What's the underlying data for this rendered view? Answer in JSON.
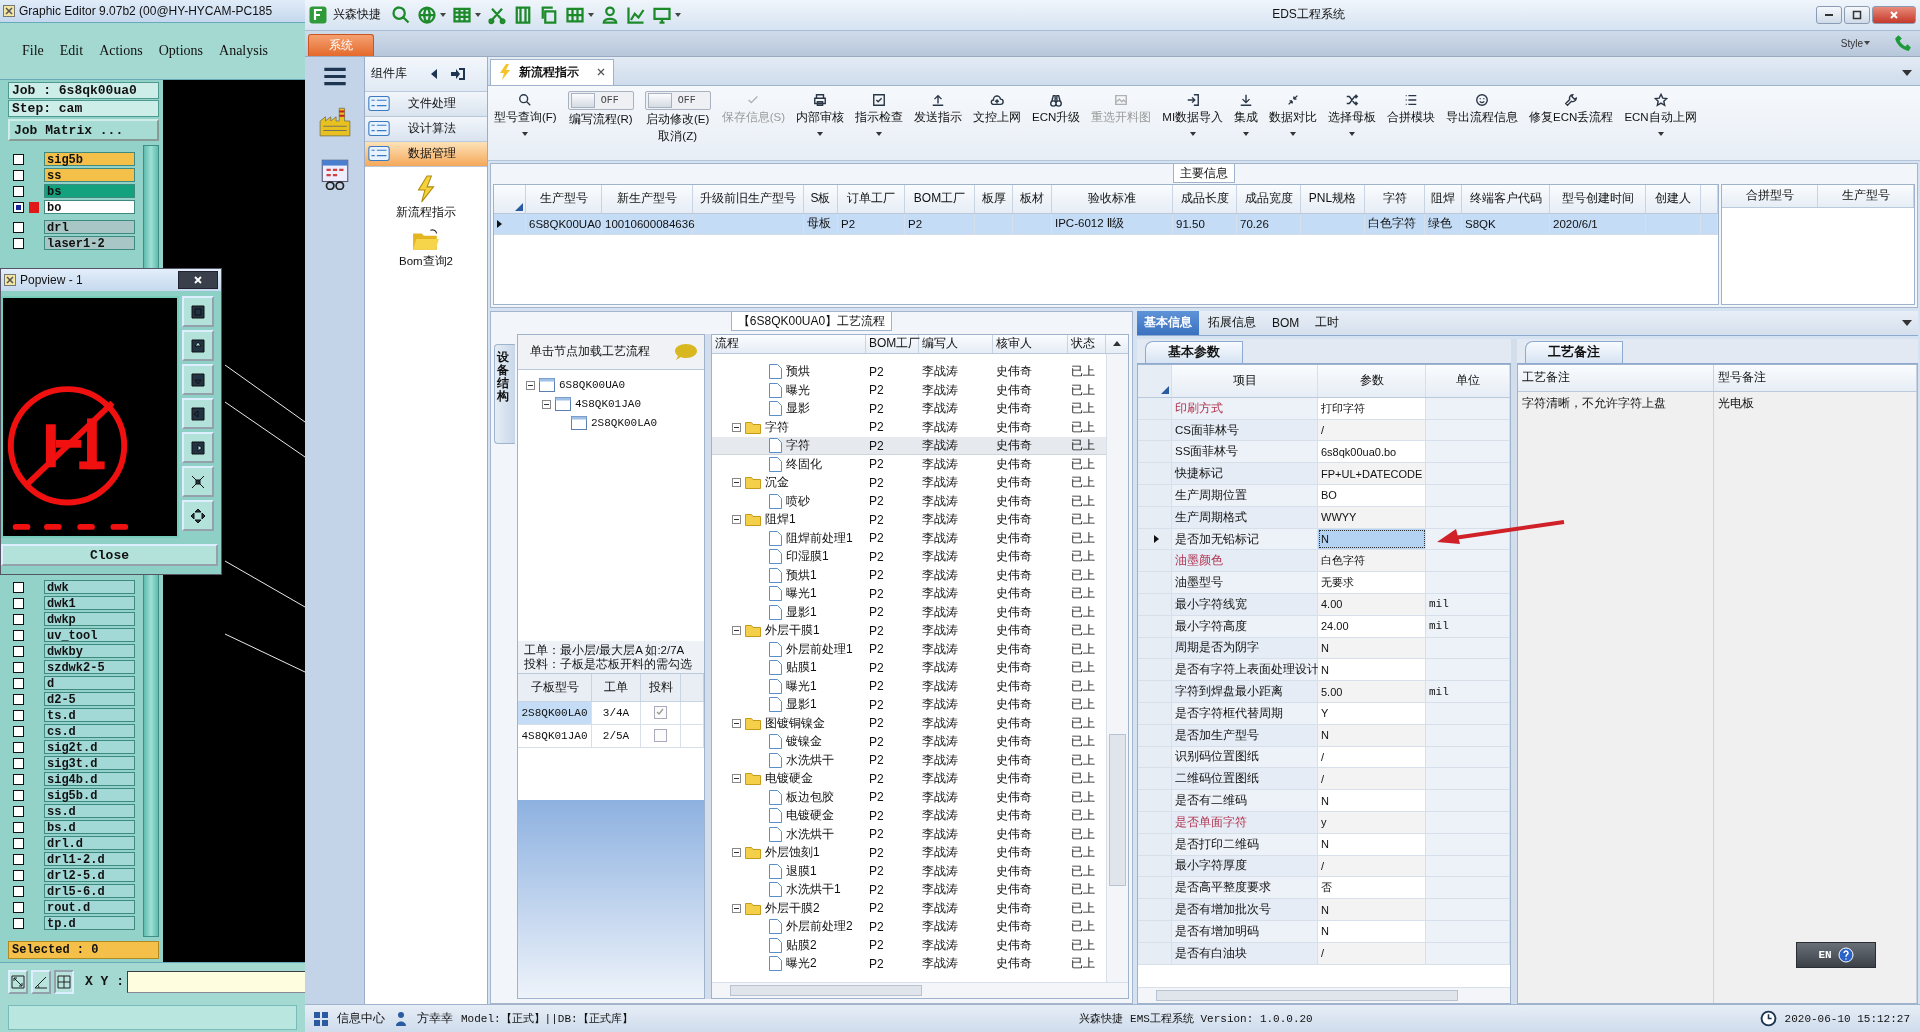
{
  "cad": {
    "title": "Graphic Editor 9.07b2 (00@HY-HYCAM-PC185",
    "menu": [
      "File",
      "Edit",
      "Actions",
      "Options",
      "Analysis"
    ],
    "job": "Job : 6s8qk00ua0",
    "step": "Step: cam",
    "matrix_button": "Job Matrix ...",
    "layers_top": [
      {
        "name": "sig5b",
        "color": "#f5c04a",
        "selected": false
      },
      {
        "name": "ss",
        "color": "#f5c04a",
        "selected": false
      },
      {
        "name": "bs",
        "color": "#14a27e",
        "selected": false
      },
      {
        "name": "bo",
        "color": "#ffffff",
        "selected": true
      },
      {
        "name": "drl",
        "color": "#a8c6c6",
        "selected": false
      },
      {
        "name": "laser1-2",
        "color": "#a8c6c6",
        "selected": false
      }
    ],
    "layers_bottom": [
      {
        "name": "dwk",
        "color": "#a2d8d6",
        "selected": false
      },
      {
        "name": "dwk1",
        "color": "#a2d8d6",
        "selected": false
      },
      {
        "name": "dwkp",
        "color": "#a2d8d6",
        "selected": false
      },
      {
        "name": "uv_tool",
        "color": "#a2d8d6",
        "selected": false
      },
      {
        "name": "dwkby",
        "color": "#a2d8d6",
        "selected": false
      },
      {
        "name": "szdwk2-5",
        "color": "#a2d8d6",
        "selected": false
      },
      {
        "name": "d",
        "color": "#a2d8d6",
        "selected": false
      },
      {
        "name": "d2-5",
        "color": "#a2d8d6",
        "selected": false
      },
      {
        "name": "ts.d",
        "color": "#a2d8d6",
        "selected": false
      },
      {
        "name": "cs.d",
        "color": "#a2d8d6",
        "selected": false
      },
      {
        "name": "sig2t.d",
        "color": "#a2d8d6",
        "selected": false
      },
      {
        "name": "sig3t.d",
        "color": "#a2d8d6",
        "selected": false
      },
      {
        "name": "sig4b.d",
        "color": "#a2d8d6",
        "selected": false
      },
      {
        "name": "sig5b.d",
        "color": "#a2d8d6",
        "selected": false
      },
      {
        "name": "ss.d",
        "color": "#a2d8d6",
        "selected": false
      },
      {
        "name": "bs.d",
        "color": "#a2d8d6",
        "selected": false
      },
      {
        "name": "drl.d",
        "color": "#a2d8d6",
        "selected": false
      },
      {
        "name": "drl1-2.d",
        "color": "#a2d8d6",
        "selected": false
      },
      {
        "name": "drl2-5.d",
        "color": "#a2d8d6",
        "selected": false
      },
      {
        "name": "drl5-6.d",
        "color": "#a2d8d6",
        "selected": false
      },
      {
        "name": "rout.d",
        "color": "#a2d8d6",
        "selected": false
      },
      {
        "name": "tp.d",
        "color": "#a2d8d6",
        "selected": false
      }
    ],
    "selected_count": "Selected : 0",
    "xy_label": "X Y :",
    "popview": {
      "title": "Popview - 1",
      "close": "Close"
    }
  },
  "app": {
    "brand": "兴森快捷",
    "title": "EDS工程系统",
    "system_tab": "系统",
    "style_label": "Style"
  },
  "nav": {
    "header": "组件库",
    "groups": [
      {
        "label": "文件处理",
        "selected": false
      },
      {
        "label": "设计算法",
        "selected": false
      },
      {
        "label": "数据管理",
        "selected": true
      }
    ],
    "items": [
      "新流程指示",
      "Bom查询2"
    ]
  },
  "document_tab": "新流程指示",
  "toolbar": [
    {
      "kind": "button",
      "label": "型号查询(F)",
      "disabled": false,
      "dropdown": true
    },
    {
      "kind": "toggle",
      "label": "编写流程(R)",
      "state": "OFF",
      "on": false
    },
    {
      "kind": "toggle",
      "label": "启动修改(E)",
      "sublabel": "取消(Z)",
      "state": "OFF",
      "on": false
    },
    {
      "kind": "button",
      "label": "保存信息(S)",
      "disabled": true,
      "dropdown": false
    },
    {
      "kind": "button",
      "label": "内部审核",
      "disabled": false,
      "dropdown": true
    },
    {
      "kind": "button",
      "label": "指示检查",
      "disabled": false,
      "dropdown": true
    },
    {
      "kind": "button",
      "label": "发送指示",
      "disabled": false,
      "dropdown": false
    },
    {
      "kind": "button",
      "label": "文控上网",
      "disabled": false,
      "dropdown": false
    },
    {
      "kind": "button",
      "label": "ECN升级",
      "disabled": false,
      "dropdown": false
    },
    {
      "kind": "button",
      "label": "重选开料图",
      "disabled": true,
      "dropdown": false
    },
    {
      "kind": "button",
      "label": "MI数据导入",
      "disabled": false,
      "dropdown": true
    },
    {
      "kind": "button",
      "label": "集成",
      "disabled": false,
      "dropdown": true
    },
    {
      "kind": "button",
      "label": "数据对比",
      "disabled": false,
      "dropdown": true
    },
    {
      "kind": "button",
      "label": "选择母板",
      "disabled": false,
      "dropdown": true
    },
    {
      "kind": "button",
      "label": "合拼模块",
      "disabled": false,
      "dropdown": false
    },
    {
      "kind": "button",
      "label": "导出流程信息",
      "disabled": false,
      "dropdown": false
    },
    {
      "kind": "button",
      "label": "修复ECN丢流程",
      "disabled": false,
      "dropdown": false
    },
    {
      "kind": "button",
      "label": "ECN自动上网",
      "disabled": false,
      "dropdown": true
    }
  ],
  "main_info": {
    "title": "主要信息",
    "columns": [
      "生产型号",
      "新生产型号",
      "升级前旧生产型号",
      "S板",
      "订单工厂",
      "BOM工厂",
      "板厚",
      "板材",
      "验收标准",
      "成品长度",
      "成品宽度",
      "PNL规格",
      "字符",
      "阻焊",
      "终端客户代码",
      "型号创建时间",
      "创建人"
    ],
    "rows": [
      {
        "selected": true,
        "cells": [
          "6S8QK00UA0",
          "10010600084636",
          null,
          "母板",
          "P2",
          "P2",
          null,
          null,
          "IPC-6012 Ⅱ级",
          "91.50",
          "70.26",
          null,
          "白色字符",
          "绿色",
          "S8QK",
          "2020/6/1",
          null
        ]
      }
    ],
    "side_columns": [
      "合拼型号",
      "生产型号"
    ]
  },
  "flow": {
    "title": "【6S8QK00UA0】工艺流程",
    "side_tab": "设备结构",
    "tree_hint": "单击节点加载工艺流程",
    "tree": [
      {
        "label": "6S8QK00UA0",
        "children": [
          {
            "label": "4S8QK01JA0",
            "children": [
              {
                "label": "2S8QK00LA0"
              }
            ]
          }
        ]
      }
    ],
    "note": [
      "工单：最小层/最大层A 如:2/7A",
      "投料：子板是芯板开料的需勾选"
    ],
    "sub_columns": [
      "子板型号",
      "工单",
      "投料"
    ],
    "sub_rows": [
      {
        "model": "2S8QK00LA0",
        "order": "3/4A",
        "checked": true,
        "selected": true
      },
      {
        "model": "4S8QK01JA0",
        "order": "2/5A",
        "checked": false,
        "selected": false
      }
    ],
    "columns": [
      "流程",
      "BOM工厂",
      "编写人",
      "核审人",
      "状态"
    ],
    "rows": [
      {
        "kind": "step",
        "name": "预烘",
        "bom": "P2",
        "writer": "李战涛",
        "reviewer": "史伟奇",
        "status": "已上",
        "selected": false
      },
      {
        "kind": "step",
        "name": "曝光",
        "bom": "P2",
        "writer": "李战涛",
        "reviewer": "史伟奇",
        "status": "已上",
        "selected": false
      },
      {
        "kind": "step",
        "name": "显影",
        "bom": "P2",
        "writer": "李战涛",
        "reviewer": "史伟奇",
        "status": "已上",
        "selected": false
      },
      {
        "kind": "folder",
        "name": "字符",
        "bom": "P2",
        "writer": "李战涛",
        "reviewer": "史伟奇",
        "status": "已上",
        "selected": false,
        "expanded": true,
        "children": [
          {
            "kind": "step",
            "name": "字符",
            "bom": "P2",
            "writer": "李战涛",
            "reviewer": "史伟奇",
            "status": "已上",
            "selected": true
          },
          {
            "kind": "step",
            "name": "终固化",
            "bom": "P2",
            "writer": "李战涛",
            "reviewer": "史伟奇",
            "status": "已上",
            "selected": false
          }
        ]
      },
      {
        "kind": "folder",
        "name": "沉金",
        "bom": "P2",
        "writer": "李战涛",
        "reviewer": "史伟奇",
        "status": "已上",
        "selected": false,
        "expanded": true,
        "children": [
          {
            "kind": "step",
            "name": "喷砂",
            "bom": "P2",
            "writer": "李战涛",
            "reviewer": "史伟奇",
            "status": "已上",
            "selected": false
          }
        ]
      },
      {
        "kind": "folder",
        "name": "阻焊1",
        "bom": "P2",
        "writer": "李战涛",
        "reviewer": "史伟奇",
        "status": "已上",
        "selected": false,
        "expanded": true,
        "children": [
          {
            "kind": "step",
            "name": "阻焊前处理1",
            "bom": "P2",
            "writer": "李战涛",
            "reviewer": "史伟奇",
            "status": "已上",
            "selected": false
          },
          {
            "kind": "step",
            "name": "印湿膜1",
            "bom": "P2",
            "writer": "李战涛",
            "reviewer": "史伟奇",
            "status": "已上",
            "selected": false
          },
          {
            "kind": "step",
            "name": "预烘1",
            "bom": "P2",
            "writer": "李战涛",
            "reviewer": "史伟奇",
            "status": "已上",
            "selected": false
          },
          {
            "kind": "step",
            "name": "曝光1",
            "bom": "P2",
            "writer": "李战涛",
            "reviewer": "史伟奇",
            "status": "已上",
            "selected": false
          },
          {
            "kind": "step",
            "name": "显影1",
            "bom": "P2",
            "writer": "李战涛",
            "reviewer": "史伟奇",
            "status": "已上",
            "selected": false
          }
        ]
      },
      {
        "kind": "folder",
        "name": "外层干膜1",
        "bom": "P2",
        "writer": "李战涛",
        "reviewer": "史伟奇",
        "status": "已上",
        "selected": false,
        "expanded": true,
        "children": [
          {
            "kind": "step",
            "name": "外层前处理1",
            "bom": "P2",
            "writer": "李战涛",
            "reviewer": "史伟奇",
            "status": "已上",
            "selected": false
          },
          {
            "kind": "step",
            "name": "贴膜1",
            "bom": "P2",
            "writer": "李战涛",
            "reviewer": "史伟奇",
            "status": "已上",
            "selected": false
          },
          {
            "kind": "step",
            "name": "曝光1",
            "bom": "P2",
            "writer": "李战涛",
            "reviewer": "史伟奇",
            "status": "已上",
            "selected": false
          },
          {
            "kind": "step",
            "name": "显影1",
            "bom": "P2",
            "writer": "李战涛",
            "reviewer": "史伟奇",
            "status": "已上",
            "selected": false
          }
        ]
      },
      {
        "kind": "folder",
        "name": "图镀铜镍金",
        "bom": "P2",
        "writer": "李战涛",
        "reviewer": "史伟奇",
        "status": "已上",
        "selected": false,
        "expanded": true,
        "children": [
          {
            "kind": "step",
            "name": "镀镍金",
            "bom": "P2",
            "writer": "李战涛",
            "reviewer": "史伟奇",
            "status": "已上",
            "selected": false
          },
          {
            "kind": "step",
            "name": "水洗烘干",
            "bom": "P2",
            "writer": "李战涛",
            "reviewer": "史伟奇",
            "status": "已上",
            "selected": false
          }
        ]
      },
      {
        "kind": "folder",
        "name": "电镀硬金",
        "bom": "P2",
        "writer": "李战涛",
        "reviewer": "史伟奇",
        "status": "已上",
        "selected": false,
        "expanded": true,
        "children": [
          {
            "kind": "step",
            "name": "板边包胶",
            "bom": "P2",
            "writer": "李战涛",
            "reviewer": "史伟奇",
            "status": "已上",
            "selected": false
          },
          {
            "kind": "step",
            "name": "电镀硬金",
            "bom": "P2",
            "writer": "李战涛",
            "reviewer": "史伟奇",
            "status": "已上",
            "selected": false
          },
          {
            "kind": "step",
            "name": "水洗烘干",
            "bom": "P2",
            "writer": "李战涛",
            "reviewer": "史伟奇",
            "status": "已上",
            "selected": false
          }
        ]
      },
      {
        "kind": "folder",
        "name": "外层蚀刻1",
        "bom": "P2",
        "writer": "李战涛",
        "reviewer": "史伟奇",
        "status": "已上",
        "selected": false,
        "expanded": true,
        "children": [
          {
            "kind": "step",
            "name": "退膜1",
            "bom": "P2",
            "writer": "李战涛",
            "reviewer": "史伟奇",
            "status": "已上",
            "selected": false
          },
          {
            "kind": "step",
            "name": "水洗烘干1",
            "bom": "P2",
            "writer": "李战涛",
            "reviewer": "史伟奇",
            "status": "已上",
            "selected": false
          }
        ]
      },
      {
        "kind": "folder",
        "name": "外层干膜2",
        "bom": "P2",
        "writer": "李战涛",
        "reviewer": "史伟奇",
        "status": "已上",
        "selected": false,
        "expanded": true,
        "children": [
          {
            "kind": "step",
            "name": "外层前处理2",
            "bom": "P2",
            "writer": "李战涛",
            "reviewer": "史伟奇",
            "status": "已上",
            "selected": false
          },
          {
            "kind": "step",
            "name": "贴膜2",
            "bom": "P2",
            "writer": "李战涛",
            "reviewer": "史伟奇",
            "status": "已上",
            "selected": false
          },
          {
            "kind": "step",
            "name": "曝光2",
            "bom": "P2",
            "writer": "李战涛",
            "reviewer": "史伟奇",
            "status": "已上",
            "selected": false
          }
        ]
      }
    ]
  },
  "details": {
    "tabs": [
      {
        "label": "基本信息",
        "selected": true
      },
      {
        "label": "拓展信息",
        "selected": false
      },
      {
        "label": "BOM",
        "selected": false
      },
      {
        "label": "工时",
        "selected": false
      }
    ],
    "params_tab": "基本参数",
    "param_columns": [
      "项目",
      "参数",
      "单位"
    ],
    "params": [
      {
        "name": "印刷方式",
        "value": "打印字符",
        "flagged": true,
        "selected": false
      },
      {
        "name": "CS面菲林号",
        "value": "/",
        "flagged": false,
        "selected": false
      },
      {
        "name": "SS面菲林号",
        "value": "6s8qk00ua0.bo",
        "flagged": false,
        "selected": false
      },
      {
        "name": "快捷标记",
        "value": "FP+UL+DATECODE",
        "flagged": false,
        "selected": false
      },
      {
        "name": "生产周期位置",
        "value": "BO",
        "flagged": false,
        "selected": false
      },
      {
        "name": "生产周期格式",
        "value": "WWYY",
        "flagged": false,
        "selected": false
      },
      {
        "name": "是否加无铅标记",
        "value": "N",
        "flagged": false,
        "selected": true
      },
      {
        "name": "油墨颜色",
        "value": "白色字符",
        "flagged": true,
        "selected": false
      },
      {
        "name": "油墨型号",
        "value": "无要求",
        "flagged": false,
        "selected": false
      },
      {
        "name": "最小字符线宽",
        "value": "4.00",
        "unit": "mil",
        "flagged": false,
        "selected": false
      },
      {
        "name": "最小字符高度",
        "value": "24.00",
        "unit": "mil",
        "flagged": false,
        "selected": false
      },
      {
        "name": "周期是否为阴字",
        "value": "N",
        "flagged": false,
        "selected": false
      },
      {
        "name": "是否有字符上表面处理设计",
        "value": "N",
        "flagged": false,
        "selected": false
      },
      {
        "name": "字符到焊盘最小距离",
        "value": "5.00",
        "unit": "mil",
        "flagged": false,
        "selected": false
      },
      {
        "name": "是否字符框代替周期",
        "value": "Y",
        "flagged": false,
        "selected": false
      },
      {
        "name": "是否加生产型号",
        "value": "N",
        "flagged": false,
        "selected": false
      },
      {
        "name": "识别码位置图纸",
        "value": "/",
        "flagged": false,
        "selected": false
      },
      {
        "name": "二维码位置图纸",
        "value": "/",
        "flagged": false,
        "selected": false
      },
      {
        "name": "是否有二维码",
        "value": "N",
        "flagged": false,
        "selected": false
      },
      {
        "name": "是否单面字符",
        "value": "y",
        "flagged": true,
        "selected": false
      },
      {
        "name": "是否打印二维码",
        "value": "N",
        "flagged": false,
        "selected": false
      },
      {
        "name": "最小字符厚度",
        "value": "/",
        "flagged": false,
        "selected": false
      },
      {
        "name": "是否高平整度要求",
        "value": "否",
        "flagged": false,
        "selected": false
      },
      {
        "name": "是否有增加批次号",
        "value": "N",
        "flagged": false,
        "selected": false
      },
      {
        "name": "是否有增加明码",
        "value": "N",
        "flagged": false,
        "selected": false
      },
      {
        "name": "是否有白油块",
        "value": "/",
        "flagged": false,
        "selected": false
      }
    ],
    "notes_tab": "工艺备注",
    "note_columns": [
      "工艺备注",
      "型号备注"
    ],
    "notes": [
      "字符清晰，不允许字符上盘",
      "光电板"
    ],
    "ime": "EN"
  },
  "status_bar": {
    "info": "信息中心",
    "user": "方幸幸",
    "model": "Model:【正式】||DB:【正式库】",
    "version": "兴森快捷 EMS工程系统 Version: 1.0.0.20",
    "time": "2020-06-10 15:12:27"
  }
}
